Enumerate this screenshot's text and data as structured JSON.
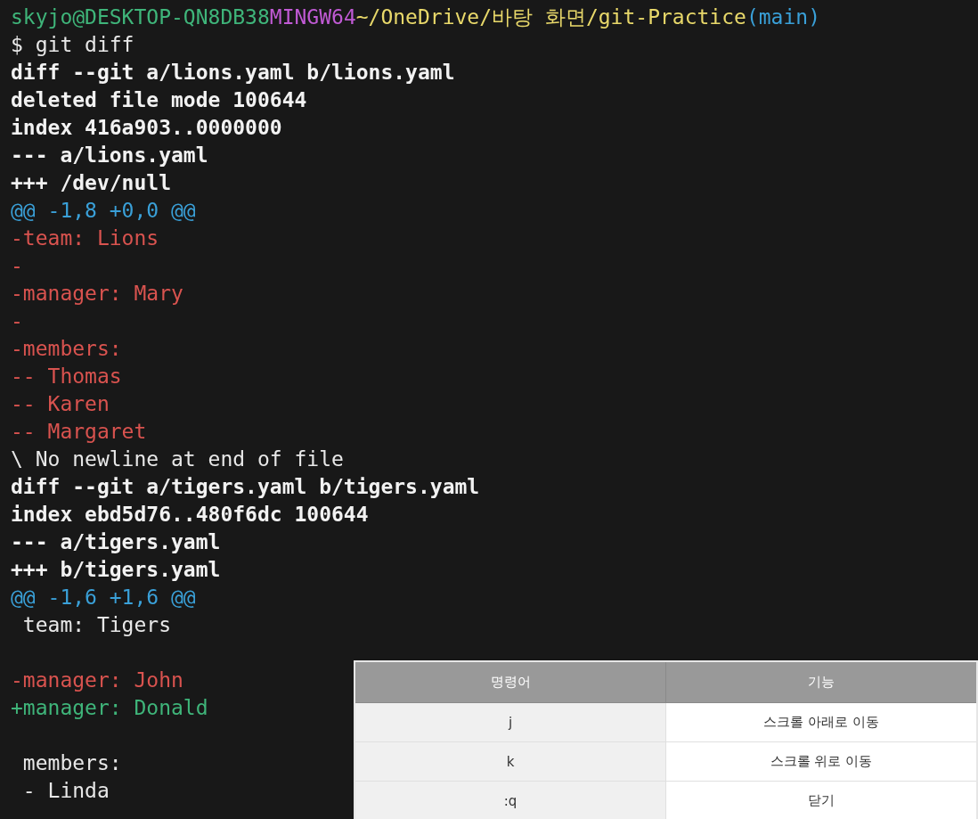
{
  "terminal": {
    "prompt": [
      {
        "text": "skyjo@DESKTOP-QN8DB38",
        "color": "#3fb57a"
      },
      {
        "text": "MINGW64",
        "color": "#c05ad4"
      },
      {
        "text": "~/OneDrive/바탕 화면/git-Practice",
        "color": "#e8d86a"
      },
      {
        "text": "(main)",
        "color": "#3aa0d8"
      }
    ],
    "lines": [
      {
        "kind": "context",
        "text": "$ git diff"
      },
      {
        "kind": "meta",
        "text": "diff --git a/lions.yaml b/lions.yaml"
      },
      {
        "kind": "meta",
        "text": "deleted file mode 100644"
      },
      {
        "kind": "meta",
        "text": "index 416a903..0000000"
      },
      {
        "kind": "meta",
        "text": "--- a/lions.yaml"
      },
      {
        "kind": "meta",
        "text": "+++ /dev/null"
      },
      {
        "kind": "hunk",
        "text": "@@ -1,8 +0,0 @@"
      },
      {
        "kind": "del",
        "text": "-team: Lions"
      },
      {
        "kind": "del",
        "text": "-"
      },
      {
        "kind": "del",
        "text": "-manager: Mary"
      },
      {
        "kind": "del",
        "text": "-"
      },
      {
        "kind": "del",
        "text": "-members:"
      },
      {
        "kind": "del",
        "text": "-- Thomas"
      },
      {
        "kind": "del",
        "text": "-- Karen"
      },
      {
        "kind": "del",
        "text": "-- Margaret"
      },
      {
        "kind": "context",
        "text": "\\ No newline at end of file"
      },
      {
        "kind": "meta",
        "text": "diff --git a/tigers.yaml b/tigers.yaml"
      },
      {
        "kind": "meta",
        "text": "index ebd5d76..480f6dc 100644"
      },
      {
        "kind": "meta",
        "text": "--- a/tigers.yaml"
      },
      {
        "kind": "meta",
        "text": "+++ b/tigers.yaml"
      },
      {
        "kind": "hunk",
        "text": "@@ -1,6 +1,6 @@"
      },
      {
        "kind": "context",
        "text": " team: Tigers"
      },
      {
        "kind": "blank"
      },
      {
        "kind": "del",
        "text": "-manager: John"
      },
      {
        "kind": "add",
        "text": "+manager: Donald"
      },
      {
        "kind": "blank"
      },
      {
        "kind": "context",
        "text": " members:"
      },
      {
        "kind": "context",
        "text": " - Linda"
      }
    ]
  },
  "table": {
    "columns": [
      "명령어",
      "기능"
    ],
    "rows": [
      [
        "j",
        "스크롤 아래로 이동"
      ],
      [
        "k",
        "스크롤 위로 이동"
      ],
      [
        ":q",
        "닫기"
      ]
    ]
  }
}
